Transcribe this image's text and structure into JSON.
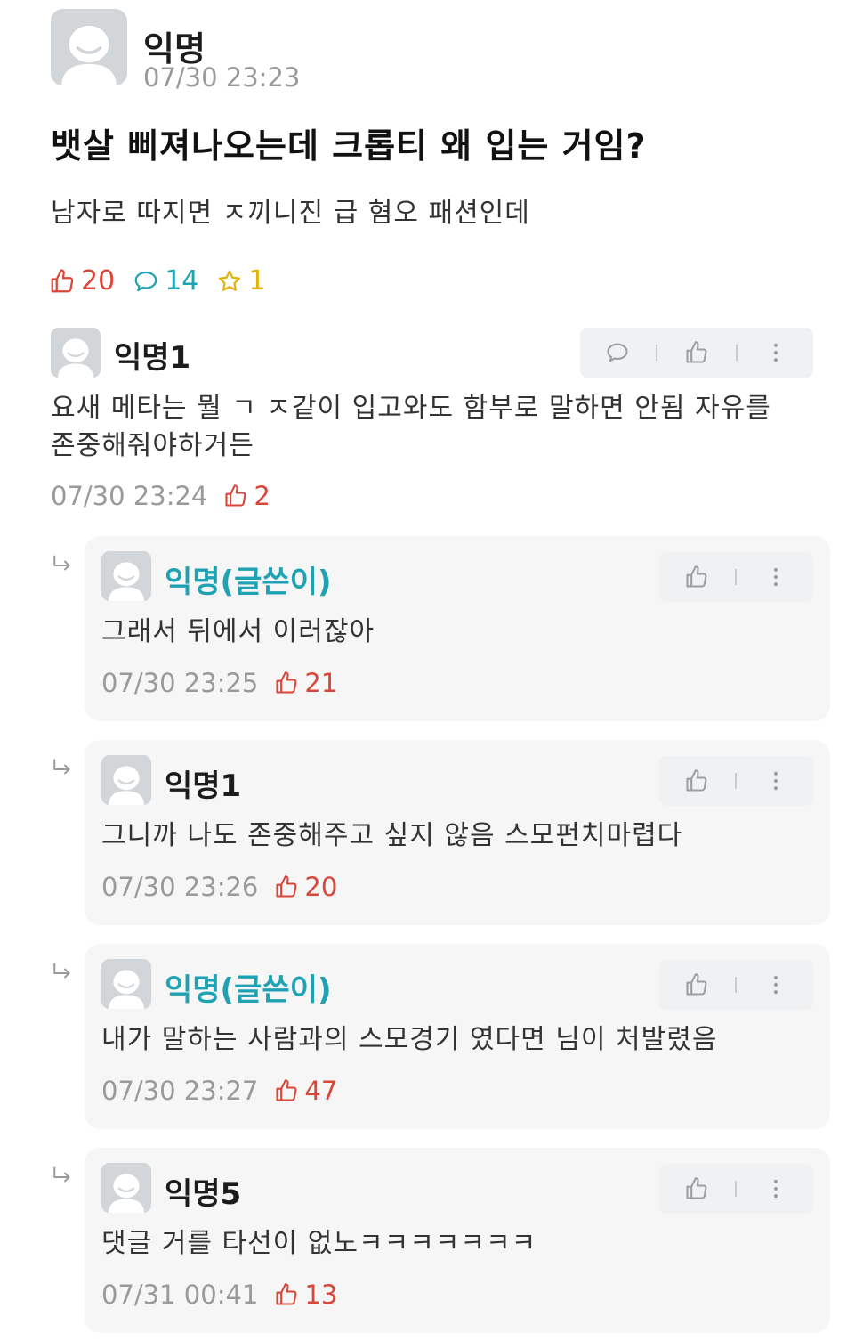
{
  "post": {
    "author": "익명",
    "time": "07/30 23:23",
    "title": "뱃살 삐져나오는데 크롭티 왜 입는 거임?",
    "body": "남자로 따지면 ㅈ끼니진 급 혐오 패션인데",
    "stats": {
      "likes": "20",
      "comments": "14",
      "scraps": "1"
    }
  },
  "comments": [
    {
      "author": "익명1",
      "text": "요새 메타는 뭘 ㄱ ㅈ같이 입고와도 함부로 말하면 안됨 자유를 존중해줘야하거든",
      "time": "07/30 23:24",
      "likes": "2"
    }
  ],
  "replies": [
    {
      "author": "익명(글쓴이)",
      "text": "그래서 뒤에서 이러잖아",
      "time": "07/30 23:25",
      "likes": "21",
      "is_author": true
    },
    {
      "author": "익명1",
      "text": "그니까 나도 존중해주고 싶지 않음 스모펀치마렵다",
      "time": "07/30 23:26",
      "likes": "20",
      "is_author": false
    },
    {
      "author": "익명(글쓴이)",
      "text": "내가 말하는 사람과의 스모경기 였다면 님이 처발렸음",
      "time": "07/30 23:27",
      "likes": "47",
      "is_author": true
    },
    {
      "author": "익명5",
      "text": "댓글 거를 타선이 없노ㅋㅋㅋㅋㅋㅋㅋ",
      "time": "07/31 00:41",
      "likes": "13",
      "is_author": false
    }
  ],
  "colors": {
    "like": "#d9473b",
    "comment": "#1fa3b4",
    "star": "#e3b20b",
    "author_name": "#1fa3b4"
  },
  "icons": [
    "avatar-placeholder-icon",
    "thumbs-up-icon",
    "speech-bubble-icon",
    "star-icon",
    "more-vertical-icon",
    "reply-arrow-icon"
  ]
}
